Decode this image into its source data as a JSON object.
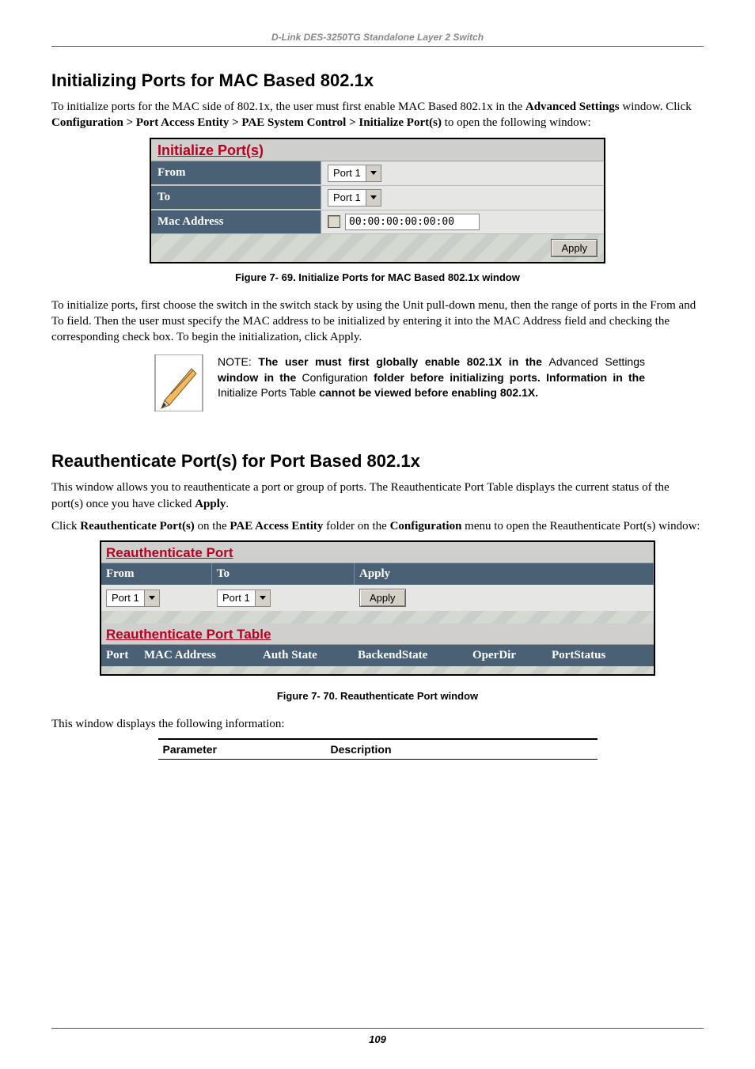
{
  "header": "D-Link DES-3250TG Standalone Layer 2 Switch",
  "page_number": "109",
  "section1": {
    "title": "Initializing Ports for MAC Based 802.1x",
    "p1a": "To initialize ports for the MAC side of 802.1x, the user must first enable MAC Based 802.1x in the ",
    "p1b": "Advanced Settings",
    "p1c": " window. Click ",
    "p1d": "Configuration > Port Access Entity > PAE System Control > Initialize Port(s)",
    "p1e": " to open the following window:",
    "panel": {
      "title": "Initialize Port(s)",
      "from_label": "From",
      "from_value": "Port 1",
      "to_label": "To",
      "to_value": "Port 1",
      "mac_label": "Mac Address",
      "mac_value": "00:00:00:00:00:00",
      "apply": "Apply"
    },
    "caption": "Figure 7- 69. Initialize Ports for MAC Based 802.1x window",
    "p2": "To initialize ports, first choose the switch in the switch stack by using the Unit pull-down menu, then the range of ports in the From and To field. Then the user must specify the MAC address to be initialized by entering it into the MAC Address field and checking the corresponding check box. To begin the initialization, click Apply.",
    "note": {
      "lead": "NOTE: ",
      "t1": "The user must first globally enable 802.1X in the ",
      "t2": "Advanced Settings ",
      "t3": "window in the ",
      "t4": "Configuration ",
      "t5": "folder before initializing ports. Information in the ",
      "t6": "Initialize Ports Table ",
      "t7": "cannot be viewed before enabling 802.1X."
    }
  },
  "section2": {
    "title": "Reauthenticate Port(s) for Port Based 802.1x",
    "p1a": "This window allows you to reauthenticate a port or group of ports. The Reauthenticate Port Table displays the current status of the port(s) once you have clicked ",
    "p1b": "Apply",
    "p1c": ".",
    "p2a": "Click ",
    "p2b": "Reauthenticate Port(s)",
    "p2c": " on the ",
    "p2d": "PAE Access Entity",
    "p2e": " folder on the ",
    "p2f": "Configuration",
    "p2g": " menu to open the Reauthenticate Port(s) window:",
    "panel": {
      "title1": "Reauthenticate Port",
      "from": "From",
      "to": "To",
      "apply_hdr": "Apply",
      "from_value": "Port 1",
      "to_value": "Port 1",
      "apply_btn": "Apply",
      "title2": "Reauthenticate Port Table",
      "cols": {
        "port": "Port",
        "mac": "MAC Address",
        "auth": "Auth State",
        "back": "BackendState",
        "oper": "OperDir",
        "stat": "PortStatus"
      }
    },
    "caption": "Figure 7- 70.  Reauthenticate Port window",
    "p3": "This window displays the following information:",
    "table": {
      "param": "Parameter",
      "desc": "Description"
    }
  }
}
